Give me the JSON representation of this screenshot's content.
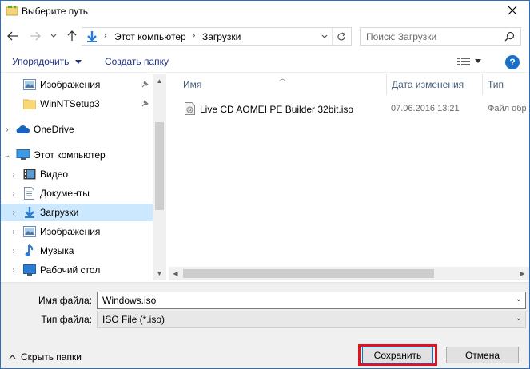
{
  "window": {
    "title": "Выберите путь"
  },
  "nav": {
    "breadcrumb": [
      "Этот компьютер",
      "Загрузки"
    ],
    "search_placeholder": "Поиск: Загрузки"
  },
  "toolbar": {
    "organize_label": "Упорядочить",
    "new_folder_label": "Создать папку"
  },
  "sidebar": {
    "items": [
      {
        "label": "Изображения",
        "icon": "pictures-icon",
        "pinned": true
      },
      {
        "label": "WinNTSetup3",
        "icon": "folder-icon",
        "pinned": true
      },
      {
        "label": "OneDrive",
        "icon": "onedrive-icon"
      },
      {
        "label": "Этот компьютер",
        "icon": "this-pc-icon"
      },
      {
        "label": "Видео",
        "icon": "video-icon"
      },
      {
        "label": "Документы",
        "icon": "documents-icon"
      },
      {
        "label": "Загрузки",
        "icon": "downloads-icon",
        "selected": true
      },
      {
        "label": "Изображения",
        "icon": "pictures-icon"
      },
      {
        "label": "Музыка",
        "icon": "music-icon"
      },
      {
        "label": "Рабочий стол",
        "icon": "desktop-icon"
      }
    ]
  },
  "columns": {
    "name": "Имя",
    "date": "Дата изменения",
    "type": "Тип"
  },
  "files": [
    {
      "name": "Live CD AOMEI PE Builder 32bit.iso",
      "date": "07.06.2016 13:21",
      "type": "Файл обр"
    }
  ],
  "form": {
    "filename_label": "Имя файла:",
    "filename_value": "Windows.iso",
    "filetype_label": "Тип файла:",
    "filetype_value": "ISO File (*.iso)"
  },
  "footer": {
    "hide_folders_label": "Скрыть папки",
    "save_label": "Сохранить",
    "cancel_label": "Отмена"
  },
  "colors": {
    "accent": "#0078d7",
    "selection": "#cce8ff",
    "highlight_outline": "#e0141e",
    "link": "#1e3287"
  }
}
